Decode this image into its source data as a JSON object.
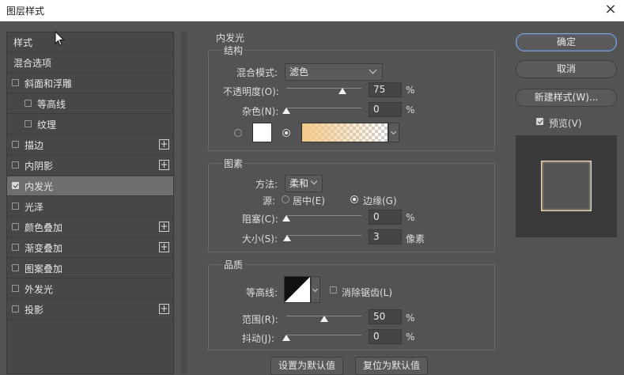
{
  "window": {
    "title": "图层样式",
    "close": "×"
  },
  "list": {
    "items": [
      {
        "label": "样式",
        "checkbox": false,
        "checked": false,
        "indent": 0,
        "plus": false,
        "selected": false
      },
      {
        "label": "混合选项",
        "checkbox": false,
        "checked": false,
        "indent": 0,
        "plus": false,
        "selected": false
      },
      {
        "label": "斜面和浮雕",
        "checkbox": true,
        "checked": false,
        "indent": 0,
        "plus": false,
        "selected": false
      },
      {
        "label": "等高线",
        "checkbox": true,
        "checked": false,
        "indent": 1,
        "plus": false,
        "selected": false
      },
      {
        "label": "纹理",
        "checkbox": true,
        "checked": false,
        "indent": 1,
        "plus": false,
        "selected": false
      },
      {
        "label": "描边",
        "checkbox": true,
        "checked": false,
        "indent": 0,
        "plus": true,
        "selected": false
      },
      {
        "label": "内阴影",
        "checkbox": true,
        "checked": false,
        "indent": 0,
        "plus": true,
        "selected": false
      },
      {
        "label": "内发光",
        "checkbox": true,
        "checked": true,
        "indent": 0,
        "plus": false,
        "selected": true
      },
      {
        "label": "光泽",
        "checkbox": true,
        "checked": false,
        "indent": 0,
        "plus": false,
        "selected": false
      },
      {
        "label": "颜色叠加",
        "checkbox": true,
        "checked": false,
        "indent": 0,
        "plus": true,
        "selected": false
      },
      {
        "label": "渐变叠加",
        "checkbox": true,
        "checked": false,
        "indent": 0,
        "plus": true,
        "selected": false
      },
      {
        "label": "图案叠加",
        "checkbox": true,
        "checked": false,
        "indent": 0,
        "plus": false,
        "selected": false
      },
      {
        "label": "外发光",
        "checkbox": true,
        "checked": false,
        "indent": 0,
        "plus": false,
        "selected": false
      },
      {
        "label": "投影",
        "checkbox": true,
        "checked": false,
        "indent": 0,
        "plus": true,
        "selected": false
      }
    ]
  },
  "inner_glow": {
    "section_title": "内发光",
    "structure": {
      "title": "结构",
      "blend_mode_label": "混合模式:",
      "blend_mode_value": "滤色",
      "opacity_label": "不透明度(O):",
      "opacity_value": "75",
      "opacity_fraction": 0.75,
      "opacity_unit": "%",
      "noise_label": "杂色(N):",
      "noise_value": "0",
      "noise_fraction": 0.0,
      "noise_unit": "%",
      "color_swatch": "#ffffff",
      "gradient_from": "#f2c98a"
    },
    "elements": {
      "title": "图素",
      "method_label": "方法:",
      "method_value": "柔和",
      "source_label": "源:",
      "source_center": "居中(E)",
      "source_edge": "边缘(G)",
      "choke_label": "阻塞(C):",
      "choke_value": "0",
      "choke_fraction": 0.0,
      "choke_unit": "%",
      "size_label": "大小(S):",
      "size_value": "3",
      "size_fraction": 0.012,
      "size_unit": "像素"
    },
    "quality": {
      "title": "品质",
      "contour_label": "等高线:",
      "antialias_label": "消除锯齿(L)",
      "range_label": "范围(R):",
      "range_value": "50",
      "range_fraction": 0.5,
      "range_unit": "%",
      "jitter_label": "抖动(J):",
      "jitter_value": "0",
      "jitter_fraction": 0.0,
      "jitter_unit": "%"
    },
    "set_default": "设置为默认值",
    "reset_default": "复位为默认值"
  },
  "buttons": {
    "ok": "确定",
    "cancel": "取消",
    "new_style": "新建样式(W)...",
    "preview_label": "预览(V)",
    "preview_checked": true
  }
}
